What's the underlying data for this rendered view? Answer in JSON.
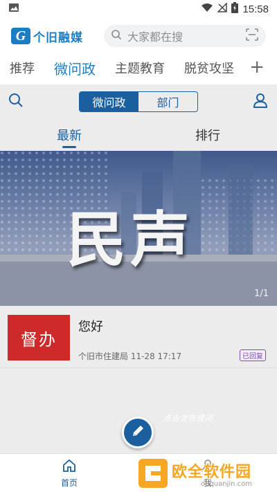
{
  "status_bar": {
    "time": "15:58"
  },
  "header": {
    "logo_text": "个旧融媒",
    "search_placeholder": "大家都在搜"
  },
  "channel_tabs": [
    {
      "label": "推荐",
      "active": false
    },
    {
      "label": "微问政",
      "active": true
    },
    {
      "label": "主题教育",
      "active": false
    },
    {
      "label": "脱贫攻坚",
      "active": false
    }
  ],
  "toolbar": {
    "segments": [
      "微问政",
      "部门"
    ]
  },
  "sub_tabs": [
    {
      "label": "最新",
      "active": true
    },
    {
      "label": "排行",
      "active": false
    }
  ],
  "banner": {
    "title": "民声",
    "pager": "1/1"
  },
  "news": [
    {
      "thumb_label": "督办",
      "title": "您好",
      "meta": "个旧市住建局 11-28 17:17",
      "badge": "已回复"
    }
  ],
  "fab_hint": "点击发布提问",
  "bottom_nav": [
    {
      "label": "首页",
      "active": true
    },
    {
      "label": "我",
      "active": false
    }
  ],
  "watermark": {
    "title": "欧全软件园",
    "sub": "ouquanjin.com"
  },
  "colors": {
    "accent": "#1b5f9e",
    "brand": "#1b7ec2",
    "badge": "#7c4ab8",
    "thumb": "#cf2a2a"
  }
}
